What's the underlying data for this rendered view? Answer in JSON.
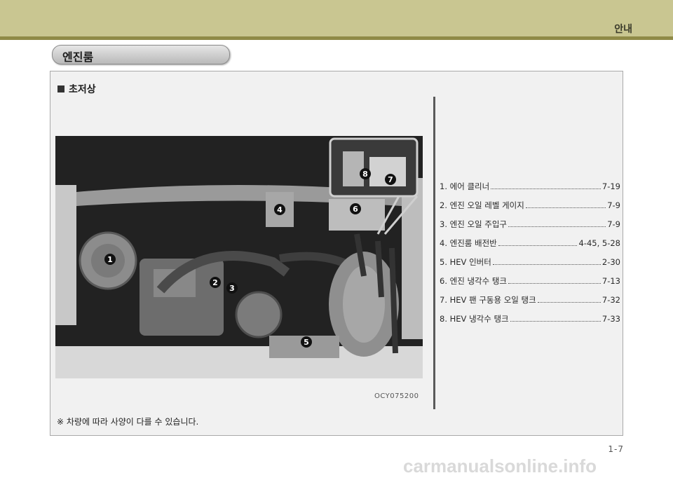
{
  "header": {
    "chapter": "안내"
  },
  "section": {
    "title": "엔진룸"
  },
  "panel": {
    "subheading": "초저상",
    "figure": {
      "code": "OCY075200",
      "callouts": [
        "1",
        "2",
        "3",
        "4",
        "5",
        "6",
        "7",
        "8"
      ]
    },
    "parts": [
      {
        "label": "1. 에어 클리너",
        "page": "7-19"
      },
      {
        "label": "2. 엔진 오일 레벨 게이지",
        "page": "7-9"
      },
      {
        "label": "3. 엔진 오일 주입구",
        "page": "7-9"
      },
      {
        "label": "4. 엔진룸 배전반",
        "page": "4-45, 5-28"
      },
      {
        "label": "5. HEV 인버터",
        "page": "2-30"
      },
      {
        "label": "6. 엔진 냉각수 탱크",
        "page": "7-13"
      },
      {
        "label": "7. HEV 팬 구동용 오일 탱크",
        "page": "7-32"
      },
      {
        "label": "8. HEV 냉각수 탱크",
        "page": "7-33"
      }
    ],
    "footnote": "※ 차량에 따라 사양이 다를 수 있습니다."
  },
  "footer": {
    "page_number": "1-7",
    "watermark": "carmanualsonline.info"
  }
}
